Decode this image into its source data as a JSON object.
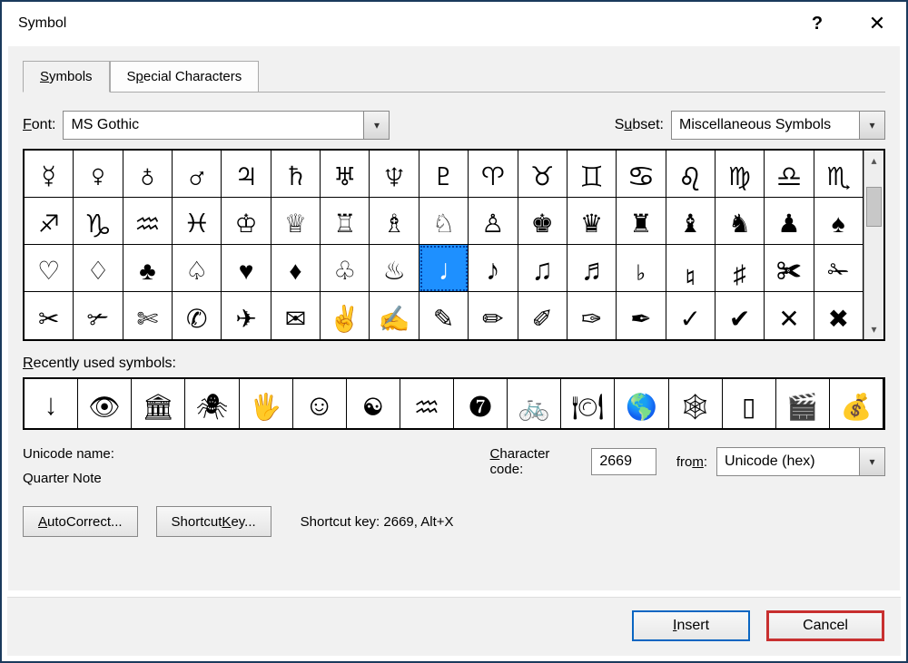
{
  "window": {
    "title": "Symbol"
  },
  "tabs": {
    "symbols": "Symbols",
    "special": "Special Characters"
  },
  "font": {
    "label": "Font:",
    "value": "MS Gothic"
  },
  "subset": {
    "label": "Subset:",
    "value": "Miscellaneous Symbols"
  },
  "grid": {
    "rows": [
      [
        "☿",
        "♀",
        "♁",
        "♂",
        "♃",
        "♄",
        "♅",
        "♆",
        "♇",
        "♈",
        "♉",
        "♊",
        "♋",
        "♌",
        "♍",
        "♎",
        "♏"
      ],
      [
        "♐",
        "♑",
        "♒",
        "♓",
        "♔",
        "♕",
        "♖",
        "♗",
        "♘",
        "♙",
        "♚",
        "♛",
        "♜",
        "♝",
        "♞",
        "♟",
        "♠"
      ],
      [
        "♡",
        "♢",
        "♣",
        "♤",
        "♥",
        "♦",
        "♧",
        "♨",
        "♩",
        "♪",
        "♫",
        "♬",
        "♭",
        "♮",
        "♯",
        "✀",
        "✁"
      ],
      [
        "✂",
        "✃",
        "✄",
        "✆",
        "✈",
        "✉",
        "✌",
        "✍",
        "✎",
        "✏",
        "✐",
        "✑",
        "✒",
        "✓",
        "✔",
        "✕",
        "✖"
      ]
    ],
    "selected": {
      "row": 2,
      "col": 8
    }
  },
  "recent": {
    "label": "Recently used symbols:",
    "items": [
      "↓",
      "👁",
      "🏛",
      "🕷",
      "🖐",
      "☺",
      "☯",
      "♒",
      "❼",
      "🚲",
      "🍽",
      "🌎",
      "🕸",
      "▯",
      "🎬",
      "💰"
    ]
  },
  "unicode": {
    "name_label": "Unicode name:",
    "name_value": "Quarter Note",
    "charcode_label": "Character code:",
    "charcode_value": "2669",
    "from_label": "from:",
    "from_value": "Unicode (hex)"
  },
  "buttons": {
    "autocorrect": "AutoCorrect...",
    "shortcut": "Shortcut Key...",
    "shortcut_info_label": "Shortcut key:",
    "shortcut_info_value": "2669, Alt+X",
    "insert": "Insert",
    "cancel": "Cancel"
  }
}
